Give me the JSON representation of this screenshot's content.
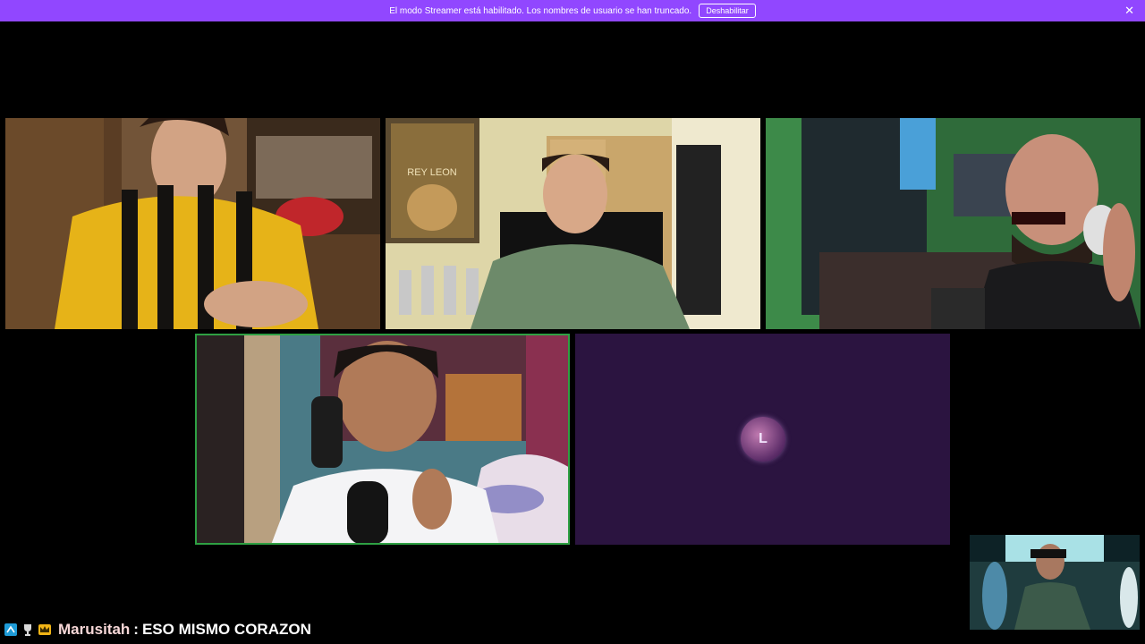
{
  "banner": {
    "message": "El modo Streamer está habilitado. Los nombres de usuario se han truncado.",
    "button_label": "Deshabilitar",
    "close_icon": "close-icon",
    "color": "#9147ff"
  },
  "tiles": [
    {
      "id": "participant-1",
      "scene": "yellow-black striped jersey, wooden room"
    },
    {
      "id": "participant-2",
      "scene": "green t-shirt, lion king poster, trophies"
    },
    {
      "id": "participant-3",
      "scene": "bald man with headphones, green room"
    },
    {
      "id": "participant-4",
      "scene": "white jersey, microphone, active speaker"
    },
    {
      "id": "participant-5",
      "scene": "logo placeholder"
    },
    {
      "id": "pip",
      "scene": "picture-in-picture video"
    }
  ],
  "colors": {
    "active_speaker_border": "#2ea043",
    "placeholder_bg": "#2b1440"
  },
  "poster_text": "REY LEON",
  "logo_text": "L",
  "chat": {
    "badges": [
      "prime-badge-icon",
      "trophy-badge-icon",
      "crown-badge-icon"
    ],
    "username": "Marusitah",
    "separator": ":",
    "message": "ESO MISMO CORAZON"
  }
}
